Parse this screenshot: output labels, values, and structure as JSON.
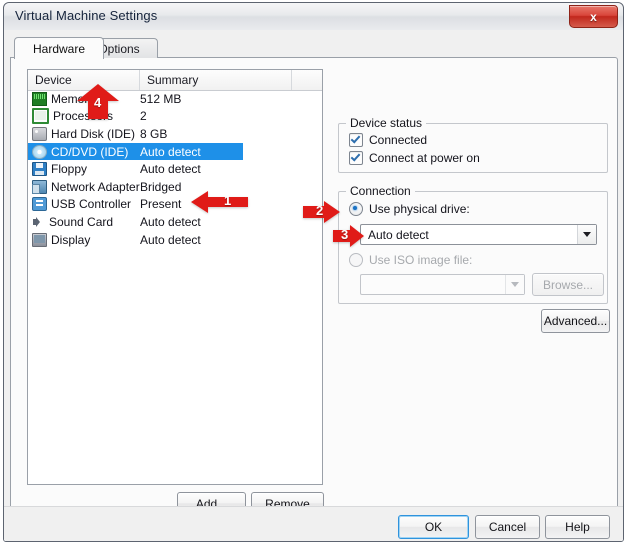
{
  "window": {
    "title": "Virtual Machine Settings",
    "close_label": "x"
  },
  "tabs": [
    {
      "label": "Hardware",
      "active": true
    },
    {
      "label": "Options",
      "active": false
    }
  ],
  "device_list": {
    "columns": [
      "Device",
      "Summary",
      ""
    ],
    "rows": [
      {
        "icon": "memory-icon",
        "device": "Memory",
        "summary": "512 MB",
        "selected": false
      },
      {
        "icon": "processor-icon",
        "device": "Processors",
        "summary": "2",
        "selected": false
      },
      {
        "icon": "hard-disk-icon",
        "device": "Hard Disk (IDE)",
        "summary": "8 GB",
        "selected": false
      },
      {
        "icon": "cd-dvd-icon",
        "device": "CD/DVD (IDE)",
        "summary": "Auto detect",
        "selected": true
      },
      {
        "icon": "floppy-icon",
        "device": "Floppy",
        "summary": "Auto detect",
        "selected": false
      },
      {
        "icon": "network-adapter-icon",
        "device": "Network Adapter",
        "summary": "Bridged",
        "selected": false
      },
      {
        "icon": "usb-controller-icon",
        "device": "USB Controller",
        "summary": "Present",
        "selected": false
      },
      {
        "icon": "sound-card-icon",
        "device": "Sound Card",
        "summary": "Auto detect",
        "selected": false
      },
      {
        "icon": "display-icon",
        "device": "Display",
        "summary": "Auto detect",
        "selected": false
      }
    ],
    "add_label": "Add...",
    "remove_label": "Remove"
  },
  "device_status": {
    "title": "Device status",
    "connected_label": "Connected",
    "connected_checked": true,
    "power_on_label": "Connect at power on",
    "power_on_checked": true
  },
  "connection": {
    "title": "Connection",
    "physical_label": "Use physical drive:",
    "physical_selected": true,
    "physical_value": "Auto detect",
    "iso_label": "Use ISO image file:",
    "iso_selected": false,
    "iso_value": "",
    "browse_label": "Browse...",
    "advanced_label": "Advanced..."
  },
  "footer": {
    "ok_label": "OK",
    "cancel_label": "Cancel",
    "help_label": "Help"
  },
  "annotations": [
    {
      "id": "1",
      "points_to": "cd-dvd-row"
    },
    {
      "id": "2",
      "points_to": "use-physical-drive-radio"
    },
    {
      "id": "3",
      "points_to": "physical-drive-combo"
    },
    {
      "id": "4",
      "points_to": "tab-options"
    }
  ],
  "colors": {
    "selection": "#1e90e8",
    "annotation": "#e01b18",
    "close_button": "#c1271c",
    "default_button_border": "#2f93dd"
  }
}
